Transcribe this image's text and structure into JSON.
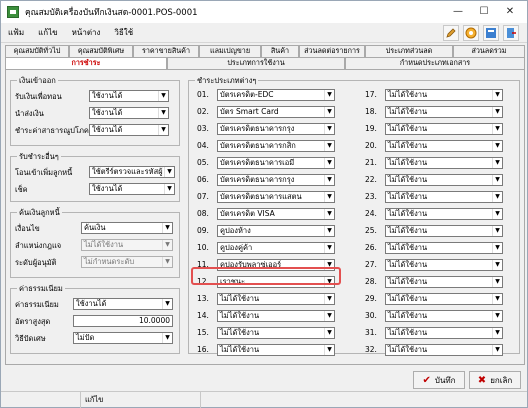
{
  "window": {
    "title": "คุณสมบัติเครื่องบันทึกเงินสด-0001.POS-0001",
    "min": "—",
    "max": "☐",
    "close": "✕"
  },
  "menu": [
    "แฟ้ม",
    "แก้ไข",
    "หน้าต่าง",
    "วิธีใช้"
  ],
  "tabs_row1": [
    "คุณสมบัติทั่วไป",
    "คุณสมบัติพิเศษ",
    "ราคาขายสินค้า",
    "แลมเปญขาย",
    "สินค้า",
    "ส่วนลดต่อรายการ",
    "ประเภทส่วนลด",
    "ส่วนลดรวม"
  ],
  "tabs_row2": [
    "การชำระ",
    "ประเภทการใช้งาน",
    "กำหนดประเภทเอกสาร"
  ],
  "active_tab": "การชำระ",
  "grp_cash": {
    "title": "เงินเข้าออก",
    "rows": [
      {
        "label": "รับเงินเพื่อทอน",
        "value": "ใช้งานได้"
      },
      {
        "label": "นำส่งเงิน",
        "value": "ใช้งานได้"
      },
      {
        "label": "ชำระค่าสาธารณูปโภค",
        "value": "ใช้งานได้"
      }
    ]
  },
  "grp_deposit": {
    "title": "รับชำระอื่นๆ",
    "rows": [
      {
        "label": "โอนเข้าเพิ่มลูกหนี้",
        "value": "ใช้ตรีร์ตรวจและรหัสผู้"
      },
      {
        "label": "เช็ค",
        "value": "ใช้งานได้"
      }
    ]
  },
  "grp_credit": {
    "title": "ค้นเงินลูกหนี้",
    "rows": [
      {
        "label": "เงื่อนไข",
        "value": "ค้นเงิน",
        "disabled": false
      },
      {
        "label": "ลำแหน่งกฎแจ",
        "value": "ไม่ได้ใช้งาน",
        "disabled": true
      },
      {
        "label": "ระดับผู้อนุมัติ",
        "value": "ไม่กำหนดระดับ",
        "disabled": true
      }
    ]
  },
  "grp_fee": {
    "title": "ค่าธรรมเนียม",
    "rows": [
      {
        "label": "ค่าธรรมเนียม",
        "value": "ใช้งานได้",
        "type": "combo"
      },
      {
        "label": "อัตราสูงสุด",
        "value": "10.0000",
        "type": "input"
      },
      {
        "label": "วิธีปัดเศษ",
        "value": "ไม่ปัด",
        "type": "combo"
      }
    ]
  },
  "grp_pay": {
    "title": "ชำระประเภทต่างๆ",
    "left": [
      {
        "no": "01.",
        "value": "บัตรเครดิต-EDC"
      },
      {
        "no": "02.",
        "value": "บัตร Smart Card"
      },
      {
        "no": "03.",
        "value": "บัตรเครดิตธนาคารกรุง"
      },
      {
        "no": "04.",
        "value": "บัตรเครดิตธนาคารกสิก"
      },
      {
        "no": "05.",
        "value": "บัตรเครดิตธนาคารเอมี"
      },
      {
        "no": "06.",
        "value": "บัตรเครดิตธนาคารกรุง"
      },
      {
        "no": "07.",
        "value": "บัตรเครดิตธนาคารแสตน"
      },
      {
        "no": "08.",
        "value": "บัตรเครดิต VISA"
      },
      {
        "no": "09.",
        "value": "คูปองห้าง"
      },
      {
        "no": "10.",
        "value": "คูปองคู่ค้า"
      },
      {
        "no": "11.",
        "value": "คูปองรับพลาซ่เออร์"
      },
      {
        "no": "12.",
        "value": "เราชนะ"
      },
      {
        "no": "13.",
        "value": "ไม่ได้ใช้งาน"
      },
      {
        "no": "14.",
        "value": "ไม่ได้ใช้งาน"
      },
      {
        "no": "15.",
        "value": "ไม่ได้ใช้งาน"
      },
      {
        "no": "16.",
        "value": "ไม่ได้ใช้งาน"
      }
    ],
    "right": [
      {
        "no": "17.",
        "value": "ไม่ได้ใช้งาน"
      },
      {
        "no": "18.",
        "value": "ไม่ได้ใช้งาน"
      },
      {
        "no": "19.",
        "value": "ไม่ได้ใช้งาน"
      },
      {
        "no": "20.",
        "value": "ไม่ได้ใช้งาน"
      },
      {
        "no": "21.",
        "value": "ไม่ได้ใช้งาน"
      },
      {
        "no": "22.",
        "value": "ไม่ได้ใช้งาน"
      },
      {
        "no": "23.",
        "value": "ไม่ได้ใช้งาน"
      },
      {
        "no": "24.",
        "value": "ไม่ได้ใช้งาน"
      },
      {
        "no": "25.",
        "value": "ไม่ได้ใช้งาน"
      },
      {
        "no": "26.",
        "value": "ไม่ได้ใช้งาน"
      },
      {
        "no": "27.",
        "value": "ไม่ได้ใช้งาน"
      },
      {
        "no": "28.",
        "value": "ไม่ได้ใช้งาน"
      },
      {
        "no": "29.",
        "value": "ไม่ได้ใช้งาน"
      },
      {
        "no": "30.",
        "value": "ไม่ได้ใช้งาน"
      },
      {
        "no": "31.",
        "value": "ไม่ได้ใช้งาน"
      },
      {
        "no": "32.",
        "value": "ไม่ได้ใช้งาน"
      }
    ]
  },
  "highlight_color": "#e35050",
  "buttons": {
    "save": "บันทึก",
    "cancel": "ยกเลิก"
  },
  "status": {
    "mode": "แก้ไข"
  },
  "icons": {
    "pencil": "pencil-icon",
    "help": "help-icon",
    "calc": "calculator-icon",
    "exit": "exit-icon",
    "dropdown": "▼",
    "check": "✔",
    "cross": "✖"
  }
}
